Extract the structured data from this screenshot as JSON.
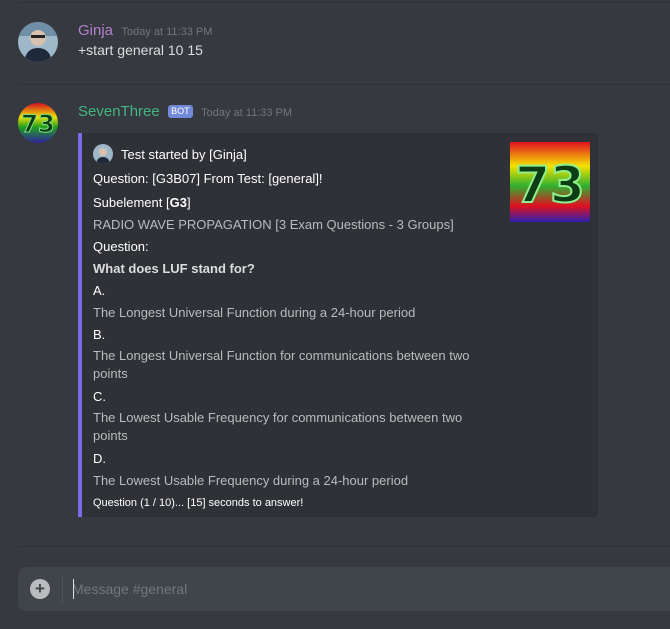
{
  "messages": [
    {
      "author": "Ginja",
      "author_color": "#b380cd",
      "timestamp": "Today at 11:33 PM",
      "content": "+start general 10 15"
    },
    {
      "author": "SevenThree",
      "author_color": "#43b581",
      "bot_tag": "BOT",
      "timestamp": "Today at 11:33 PM",
      "embed": {
        "accent_color": "#7a6ae6",
        "author_text": "Test started by [Ginja]",
        "thumbnail_text": "73",
        "title": "Question: [G3B07] From Test: [general]!",
        "subelement_prefix": "Subelement [",
        "subelement_code": "G3",
        "subelement_suffix": "]",
        "subelement_desc": "RADIO WAVE PROPAGATION [3 Exam Questions - 3 Groups]",
        "question_label": "Question:",
        "question_text": "What does LUF stand for?",
        "options": [
          {
            "letter": "A.",
            "text": "The Longest Universal Function during a 24-hour period"
          },
          {
            "letter": "B.",
            "text": "The Longest Universal Function for communications between two points"
          },
          {
            "letter": "C.",
            "text": "The Lowest Usable Frequency for communications between two points"
          },
          {
            "letter": "D.",
            "text": "The Lowest Usable Frequency during a 24-hour period"
          }
        ],
        "footer": "Question (1 / 10)... [15] seconds to answer!"
      }
    }
  ],
  "composer": {
    "placeholder": "Message #general",
    "icon": "plus-circle-icon"
  }
}
